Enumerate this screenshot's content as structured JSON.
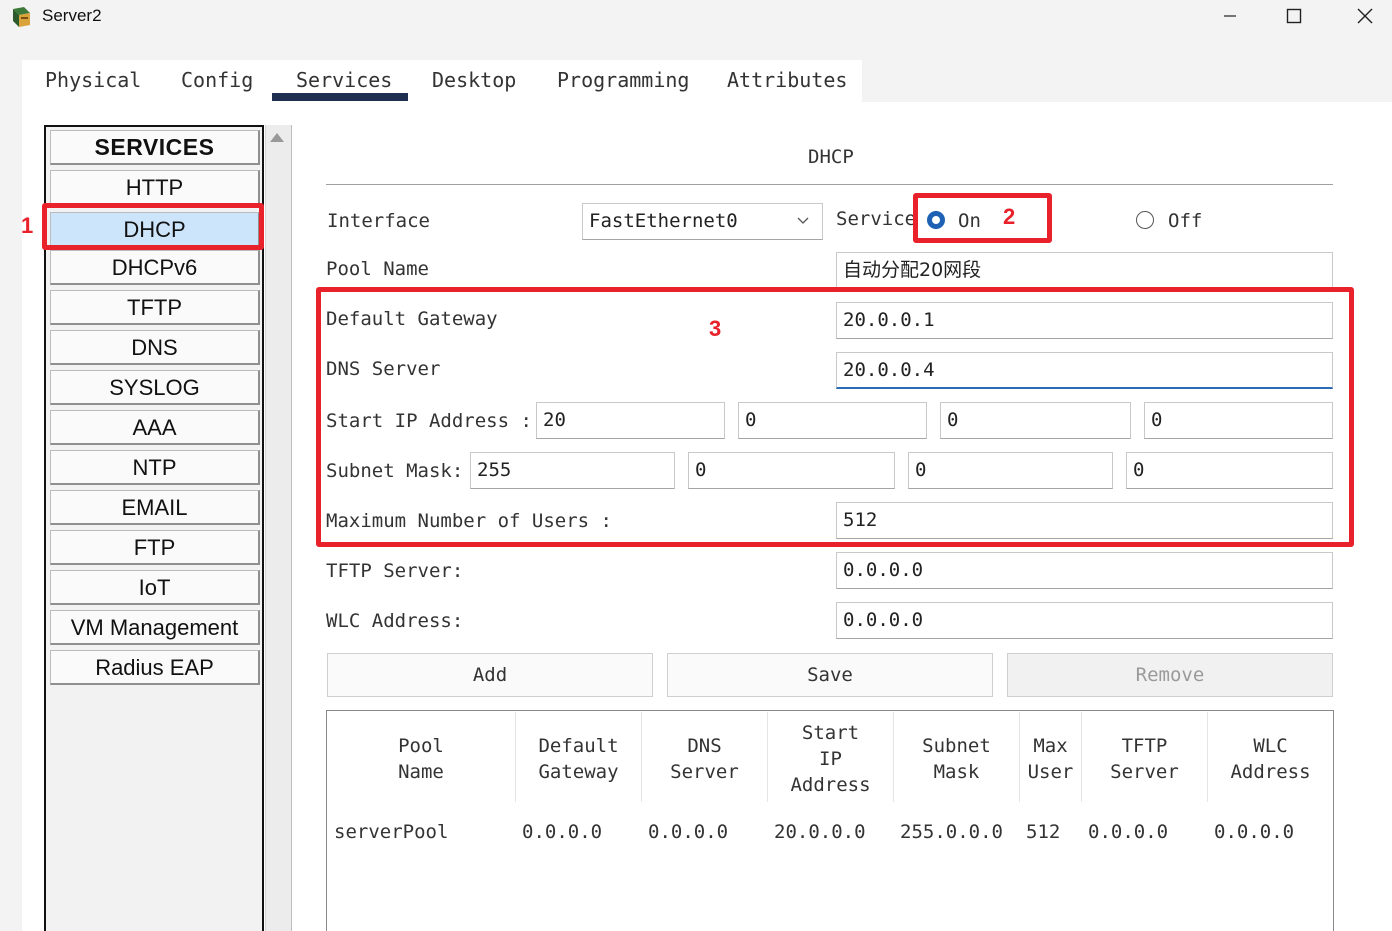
{
  "window": {
    "title": "Server2"
  },
  "tabs": [
    "Physical",
    "Config",
    "Services",
    "Desktop",
    "Programming",
    "Attributes"
  ],
  "active_tab": "Services",
  "sidebar": {
    "header": "SERVICES",
    "items": [
      "HTTP",
      "DHCP",
      "DHCPv6",
      "TFTP",
      "DNS",
      "SYSLOG",
      "AAA",
      "NTP",
      "EMAIL",
      "FTP",
      "IoT",
      "VM Management",
      "Radius EAP"
    ],
    "selected": "DHCP"
  },
  "panel": {
    "title": "DHCP",
    "interface_label": "Interface",
    "interface_value": "FastEthernet0",
    "service_label": "Service",
    "on_label": "On",
    "off_label": "Off",
    "service_state": "On",
    "pool_name_label": "Pool Name",
    "pool_name_value": "自动分配20网段",
    "default_gateway_label": "Default Gateway",
    "default_gateway_value": "20.0.0.1",
    "dns_server_label": "DNS Server",
    "dns_server_value": "20.0.0.4",
    "start_ip_label": "Start IP Address :",
    "start_ip": [
      "20",
      "0",
      "0",
      "0"
    ],
    "subnet_mask_label": "Subnet Mask:",
    "subnet_mask": [
      "255",
      "0",
      "0",
      "0"
    ],
    "max_users_label": "Maximum Number of Users :",
    "max_users_value": "512",
    "tftp_label": "TFTP Server:",
    "tftp_value": "0.0.0.0",
    "wlc_label": "WLC Address:",
    "wlc_value": "0.0.0.0",
    "buttons": {
      "add": "Add",
      "save": "Save",
      "remove": "Remove"
    }
  },
  "table": {
    "headers": [
      [
        "Pool",
        "Name"
      ],
      [
        "Default",
        "Gateway"
      ],
      [
        "DNS",
        "Server"
      ],
      [
        "Start",
        "IP",
        "Address"
      ],
      [
        "Subnet",
        "Mask"
      ],
      [
        "Max",
        "User"
      ],
      [
        "TFTP",
        "Server"
      ],
      [
        "WLC",
        "Address"
      ]
    ],
    "rows": [
      [
        "serverPool",
        "0.0.0.0",
        "0.0.0.0",
        "20.0.0.0",
        "255.0.0.0",
        "512",
        "0.0.0.0",
        "0.0.0.0"
      ]
    ]
  },
  "annotations": {
    "a1": "1",
    "a2": "2",
    "a3": "3",
    "color": "#e8212b"
  }
}
